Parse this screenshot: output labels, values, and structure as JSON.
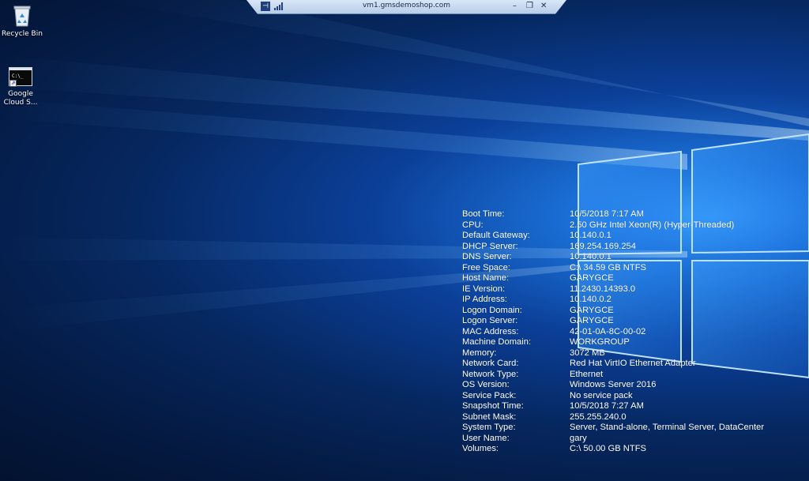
{
  "rdp_bar": {
    "title": "vm1.gmsdemoshop.com",
    "pin_icon": "pin-icon",
    "signal_icon": "connection-bars-icon",
    "minimize": "–",
    "restore": "❐",
    "close": "✕"
  },
  "desktop_icons": [
    {
      "label": "Recycle Bin",
      "icon": "recycle-bin-icon"
    },
    {
      "label": "Google Cloud S...",
      "icon": "command-prompt-shortcut-icon",
      "glyph": "C:\\_"
    }
  ],
  "bginfo": [
    {
      "label": "Boot Time:",
      "value": "10/5/2018 7:17 AM"
    },
    {
      "label": "CPU:",
      "value": "2.50 GHz Intel Xeon(R) (Hyper-Threaded)"
    },
    {
      "label": "Default Gateway:",
      "value": "10.140.0.1"
    },
    {
      "label": "DHCP Server:",
      "value": "169.254.169.254"
    },
    {
      "label": "DNS Server:",
      "value": "10.140.0.1"
    },
    {
      "label": "Free Space:",
      "value": "C:\\ 34.59 GB NTFS"
    },
    {
      "label": "Host Name:",
      "value": "GARYGCE"
    },
    {
      "label": "IE Version:",
      "value": "11.2430.14393.0"
    },
    {
      "label": "IP Address:",
      "value": "10.140.0.2"
    },
    {
      "label": "Logon Domain:",
      "value": "GARYGCE"
    },
    {
      "label": "Logon Server:",
      "value": "GARYGCE"
    },
    {
      "label": "MAC Address:",
      "value": "42-01-0A-8C-00-02"
    },
    {
      "label": "Machine Domain:",
      "value": "WORKGROUP"
    },
    {
      "label": "Memory:",
      "value": "3072 MB"
    },
    {
      "label": "Network Card:",
      "value": "Red Hat VirtIO Ethernet Adapter"
    },
    {
      "label": "Network Type:",
      "value": "Ethernet"
    },
    {
      "label": "OS Version:",
      "value": "Windows Server 2016"
    },
    {
      "label": "Service Pack:",
      "value": "No service pack"
    },
    {
      "label": "Snapshot Time:",
      "value": "10/5/2018 7:27 AM"
    },
    {
      "label": "Subnet Mask:",
      "value": "255.255.240.0"
    },
    {
      "label": "System Type:",
      "value": "Server, Stand-alone, Terminal Server, DataCenter"
    },
    {
      "label": "User Name:",
      "value": "gary"
    },
    {
      "label": "Volumes:",
      "value": "C:\\ 50.00 GB NTFS"
    }
  ],
  "colors": {
    "wallpaper_dark": "#03122f",
    "wallpaper_glow": "#3aa0ff",
    "text": "#ffffff",
    "rdp_bar": "#c8daf0"
  }
}
